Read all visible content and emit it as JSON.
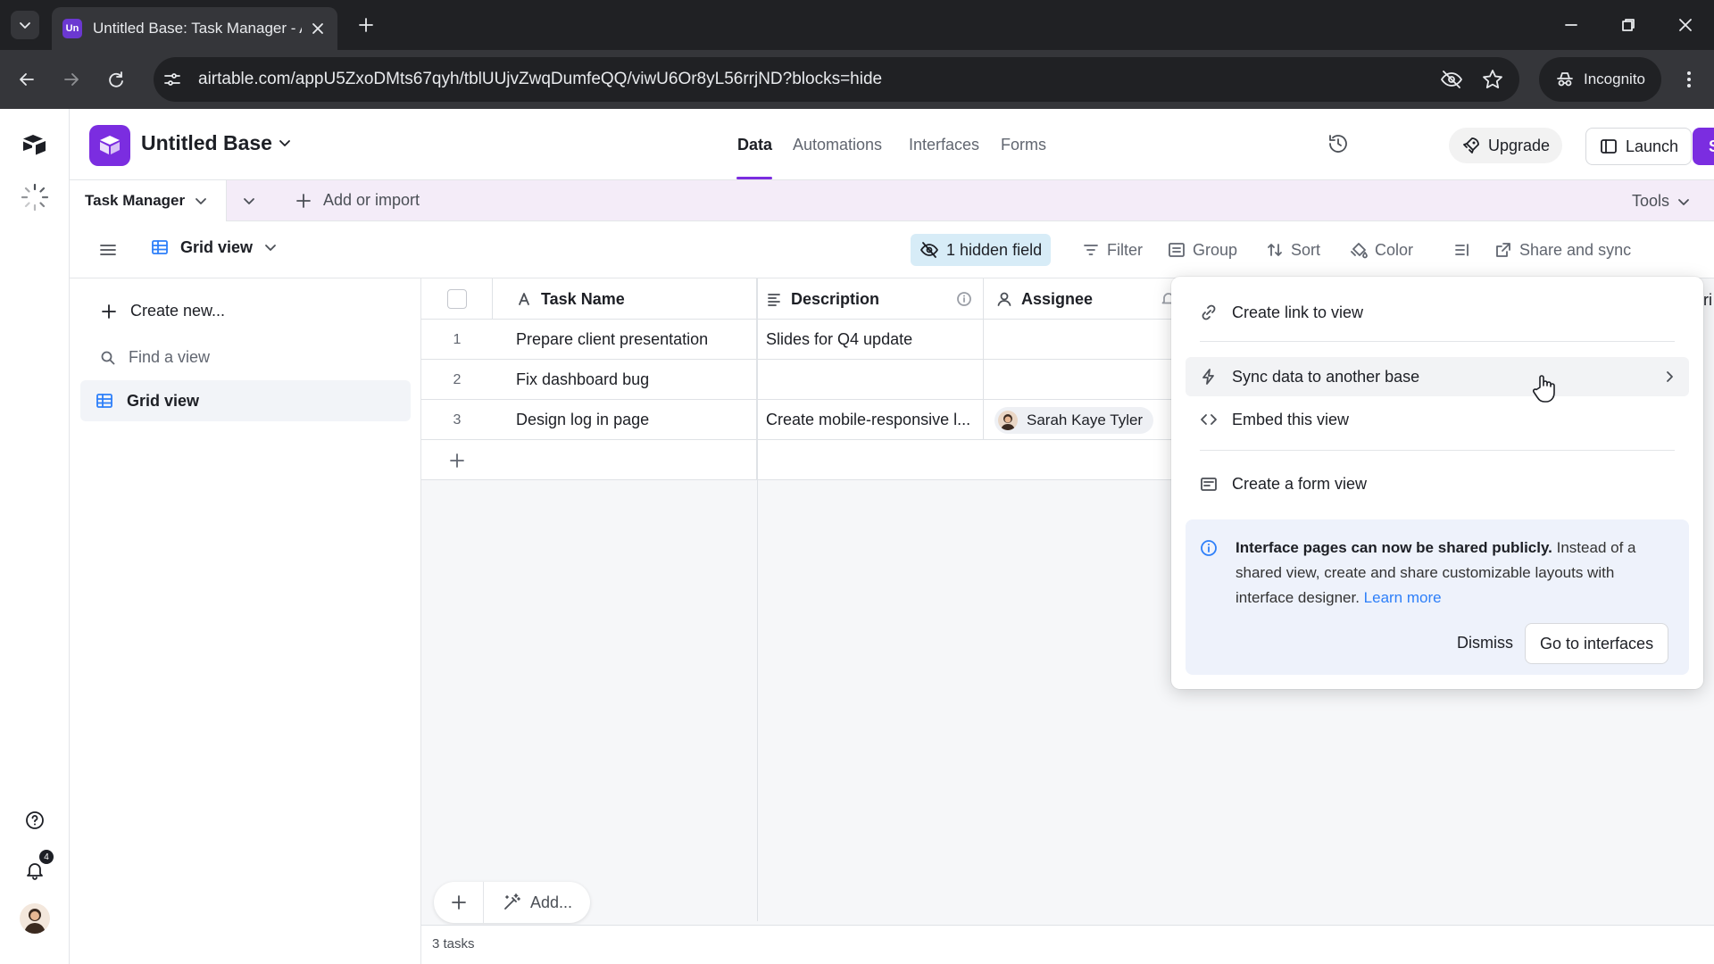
{
  "browser": {
    "tab_title": "Untitled Base: Task Manager - A",
    "favicon_text": "Un",
    "url": "airtable.com/appU5ZxoDMts67qyh/tblUUjvZwqDumfeQQ/viwU6Or8yL56rrjND?blocks=hide",
    "incognito_label": "Incognito"
  },
  "app": {
    "base_name": "Untitled Base",
    "nav_tabs": [
      "Data",
      "Automations",
      "Interfaces",
      "Forms"
    ],
    "active_tab": "Data",
    "upgrade_label": "Upgrade",
    "launch_label": "Launch",
    "share_label": "Share",
    "accent_color": "#7b2de0"
  },
  "tablebar": {
    "table_name": "Task Manager",
    "add_import_label": "Add or import",
    "tools_label": "Tools"
  },
  "viewbar": {
    "view_name": "Grid view",
    "hidden_field_label": "1 hidden field",
    "filter_label": "Filter",
    "group_label": "Group",
    "sort_label": "Sort",
    "color_label": "Color",
    "share_sync_label": "Share and sync"
  },
  "sidebar": {
    "create_new_label": "Create new...",
    "find_placeholder": "Find a view",
    "views": [
      "Grid view"
    ]
  },
  "grid": {
    "columns": [
      "Task Name",
      "Description",
      "Assignee"
    ],
    "rows": [
      {
        "num": "1",
        "task": "Prepare client presentation",
        "description": "Slides for Q4 update",
        "assignee": ""
      },
      {
        "num": "2",
        "task": "Fix dashboard bug",
        "description": "",
        "assignee": ""
      },
      {
        "num": "3",
        "task": "Design log in page",
        "description": "Create mobile-responsive l...",
        "assignee": "Sarah Kaye Tyler"
      }
    ],
    "add_label": "Add...",
    "record_count": "3 tasks"
  },
  "share_menu": {
    "items": [
      "Create link to view",
      "Sync data to another base",
      "Embed this view",
      "Create a form view"
    ],
    "info_bold": "Interface pages can now be shared publicly.",
    "info_text": " Instead of a shared view, create and share customizable layouts with interface designer. ",
    "info_link": "Learn more",
    "dismiss_label": "Dismiss",
    "goto_label": "Go to interfaces"
  },
  "rail": {
    "notification_count": "4"
  }
}
